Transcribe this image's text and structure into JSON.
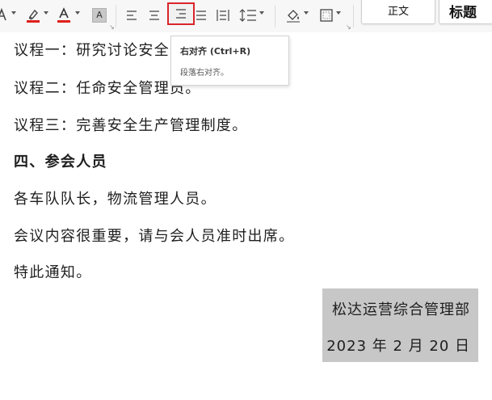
{
  "ribbon": {
    "char_shading_label": "A",
    "style_normal": "正文",
    "style_heading": "标题",
    "colors": {
      "highlight": "#e0201b",
      "font_color": "#e0201b",
      "active_border": "#d9252a"
    }
  },
  "tooltip": {
    "title": "右对齐 (Ctrl+R)",
    "description": "段落右对齐。"
  },
  "document": {
    "lines": [
      "议程一：研究讨论安全",
      "议程二：任命安全管理员。",
      "议程三：完善安全生产管理制度。",
      "四、参会人员",
      "各车队队长，物流管理人员。",
      "会议内容很重要，请与会人员准时出席。",
      "特此通知。"
    ],
    "signature": "松达运营综合管理部",
    "date": "2023 年 2 月 20 日"
  }
}
